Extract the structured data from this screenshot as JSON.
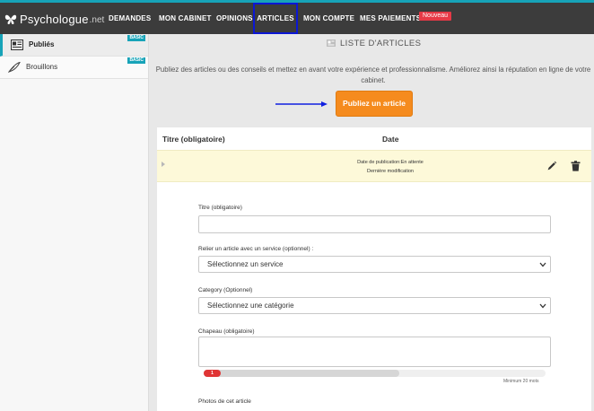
{
  "colors": {
    "accent": "#17a3b8",
    "nav_bg": "#3c3c3c",
    "publish_button": "#f58b1e",
    "row_highlight": "#fdf9d9",
    "badge_new": "#e63946",
    "progress_fill": "#e03535"
  },
  "nav": {
    "logo_text": "Psychologue",
    "logo_suffix": ".net",
    "items": [
      {
        "label": "DEMANDES"
      },
      {
        "label": "MON CABINET"
      },
      {
        "label": "OPINIONS"
      },
      {
        "label": "ARTICLES",
        "active": true
      },
      {
        "label": "MON COMPTE"
      },
      {
        "label": "MES PAIEMENTS"
      }
    ],
    "new_badge": "Nouveau"
  },
  "sidebar": {
    "items": [
      {
        "label": "Publiés",
        "badge": "BASIC",
        "icon": "newspaper-icon",
        "active": true
      },
      {
        "label": "Brouillons",
        "badge": "BASIC",
        "icon": "quill-icon",
        "active": false
      }
    ]
  },
  "main": {
    "title": "LISTE D'ARTICLES",
    "intro": "Publiez des articles ou des conseils et mettez en avant votre expérience et professionnalisme. Améliorez ainsi la réputation en ligne de votre cabinet.",
    "publish_button": "Publiez un article",
    "table": {
      "columns": [
        "Titre (obligatoire)",
        "Date"
      ],
      "row": {
        "publication_label": "Date de publication:",
        "publication_status": "En attente",
        "last_modified": "Dernière modification"
      }
    },
    "form": {
      "title_label": "Titre (obligatoire)",
      "title_value": "",
      "service_label": "Relier un article avec un service (optionnel) :",
      "service_selected": "Sélectionnez un service",
      "category_label": "Category (Optionnel)",
      "category_selected": "Sélectionnez une catégorie",
      "chapeau_label": "Chapeau (obligatoire)",
      "chapeau_value": "",
      "progress_count": "1",
      "progress_fraction": 0.003,
      "progress_caption": "Minimum 20 mots",
      "photos_label": "Photos de cet article"
    }
  }
}
